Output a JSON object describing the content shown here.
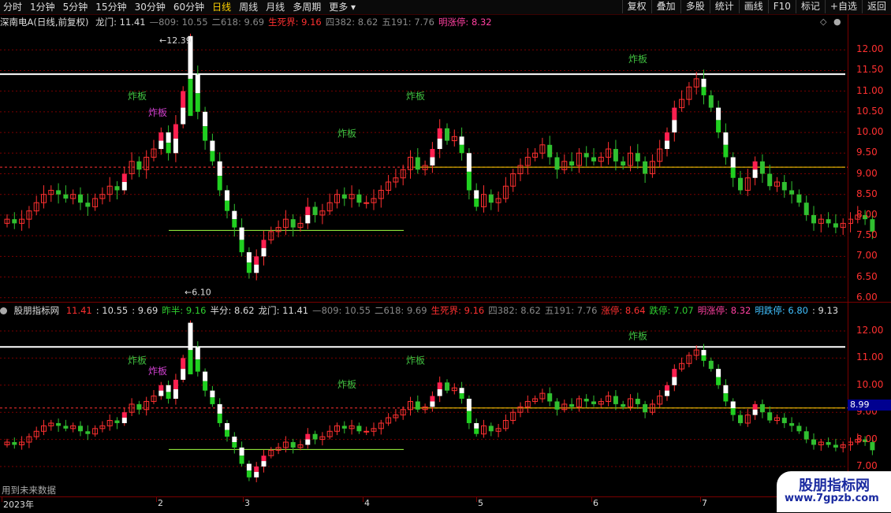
{
  "toolbar": {
    "periods": [
      "分时",
      "1分钟",
      "5分钟",
      "15分钟",
      "30分钟",
      "60分钟",
      "日线",
      "周线",
      "月线",
      "多周期",
      "更多"
    ],
    "tools": [
      "复权",
      "叠加",
      "多股",
      "统计",
      "画线",
      "F10",
      "标记",
      "+自选",
      "返回"
    ]
  },
  "main_panel": {
    "stock_name": "深南电A(日线,前复权)",
    "indicators": [
      {
        "label": "龙门: 11.41",
        "color": "w"
      },
      {
        "label": "—809: 10.55",
        "color": "g"
      },
      {
        "label": "二618: 9.69",
        "color": "g"
      },
      {
        "label": "生死界: 9.16",
        "color": "r"
      },
      {
        "label": "四382: 8.62",
        "color": "g"
      },
      {
        "label": "五191: 7.76",
        "color": "g"
      },
      {
        "label": "明涨停: 8.32",
        "color": "m"
      }
    ],
    "price_ticks": [
      "12.00",
      "11.50",
      "11.00",
      "10.50",
      "10.00",
      "9.50",
      "9.00",
      "8.50",
      "8.00",
      "7.50",
      "7.00",
      "6.50",
      "6.00"
    ],
    "high_label": "12.39",
    "low_label": "6.10",
    "annotations": [
      "炸板",
      "炸板",
      "炸板",
      "炸板",
      "炸板"
    ]
  },
  "sub_panel": {
    "title": "股朋指标网",
    "indicators": [
      {
        "label": "11.41",
        "color": "r"
      },
      {
        "label": ": 10.55",
        "color": "w"
      },
      {
        "label": ": 9.69",
        "color": "w"
      },
      {
        "label": "昨半: 9.16",
        "color": "gr"
      },
      {
        "label": "半分: 8.62",
        "color": "w"
      },
      {
        "label": "龙门: 11.41",
        "color": "w"
      },
      {
        "label": "—809: 10.55",
        "color": "g"
      },
      {
        "label": "二618: 9.69",
        "color": "g"
      },
      {
        "label": "生死界: 9.16",
        "color": "r"
      },
      {
        "label": "四382: 8.62",
        "color": "g"
      },
      {
        "label": "五191: 7.76",
        "color": "g"
      },
      {
        "label": "涨停: 8.64",
        "color": "r"
      },
      {
        "label": "跌停: 7.07",
        "color": "gr"
      },
      {
        "label": "明涨停: 8.32",
        "color": "m"
      },
      {
        "label": "明跌停: 6.80",
        "color": "c"
      },
      {
        "label": ": 9.13",
        "color": "w"
      }
    ],
    "price_ticks": [
      "12.00",
      "11.00",
      "10.00",
      "9.00",
      "8.00",
      "7.00"
    ],
    "current_price": "8.99",
    "annotations": [
      "炸板",
      "炸板",
      "炸板",
      "炸板",
      "炸板"
    ]
  },
  "footer": {
    "future_note": "用到未来数据",
    "dates": [
      "2023年",
      "2",
      "3",
      "4",
      "5",
      "6",
      "7"
    ]
  },
  "watermark": {
    "line1": "股朋指标网",
    "line2": "www.7gpzb.com"
  },
  "colors": {
    "up": "#ff3030",
    "down": "#30c030",
    "zhaban": "#ff2050",
    "white": "#ffffff",
    "grid": "#7a0000"
  },
  "chart_data": {
    "type": "candlestick",
    "title": "深南电A(日线,前复权)",
    "x_months": [
      "2023-01",
      "2023-02",
      "2023-03",
      "2023-04",
      "2023-05",
      "2023-06",
      "2023-07"
    ],
    "ylim": [
      5.8,
      12.5
    ],
    "reference_lines": {
      "龙门": 11.41,
      "生死界": 9.16,
      "support": 7.63
    },
    "high": 12.39,
    "low": 6.1,
    "close_series": [
      7.9,
      7.8,
      7.9,
      8.1,
      8.3,
      8.5,
      8.6,
      8.5,
      8.4,
      8.5,
      8.3,
      8.2,
      8.4,
      8.5,
      8.7,
      8.6,
      9.0,
      9.3,
      9.1,
      9.4,
      9.6,
      10.0,
      9.5,
      10.2,
      11.0,
      11.4,
      10.5,
      9.8,
      9.3,
      8.6,
      8.1,
      7.7,
      7.1,
      6.6,
      7.0,
      7.4,
      7.6,
      7.7,
      7.9,
      7.7,
      7.8,
      8.2,
      8.0,
      8.1,
      8.3,
      8.5,
      8.4,
      8.5,
      8.3,
      8.3,
      8.4,
      8.6,
      8.8,
      8.9,
      9.1,
      9.4,
      9.1,
      9.2,
      9.6,
      10.1,
      9.8,
      9.9,
      9.5,
      8.6,
      8.2,
      8.5,
      8.3,
      8.4,
      8.7,
      9.0,
      9.2,
      9.4,
      9.5,
      9.7,
      9.4,
      9.1,
      9.3,
      9.2,
      9.5,
      9.4,
      9.3,
      9.4,
      9.6,
      9.3,
      9.2,
      9.5,
      9.3,
      9.0,
      9.3,
      9.6,
      10.0,
      10.6,
      10.8,
      11.1,
      11.3,
      10.9,
      10.6,
      10.0,
      9.4,
      8.9,
      8.6,
      8.9,
      9.3,
      9.0,
      8.7,
      8.8,
      8.6,
      8.5,
      8.3,
      8.0,
      7.8,
      7.9,
      7.8,
      7.7,
      7.8,
      7.9,
      8.0,
      7.9,
      7.6
    ]
  }
}
